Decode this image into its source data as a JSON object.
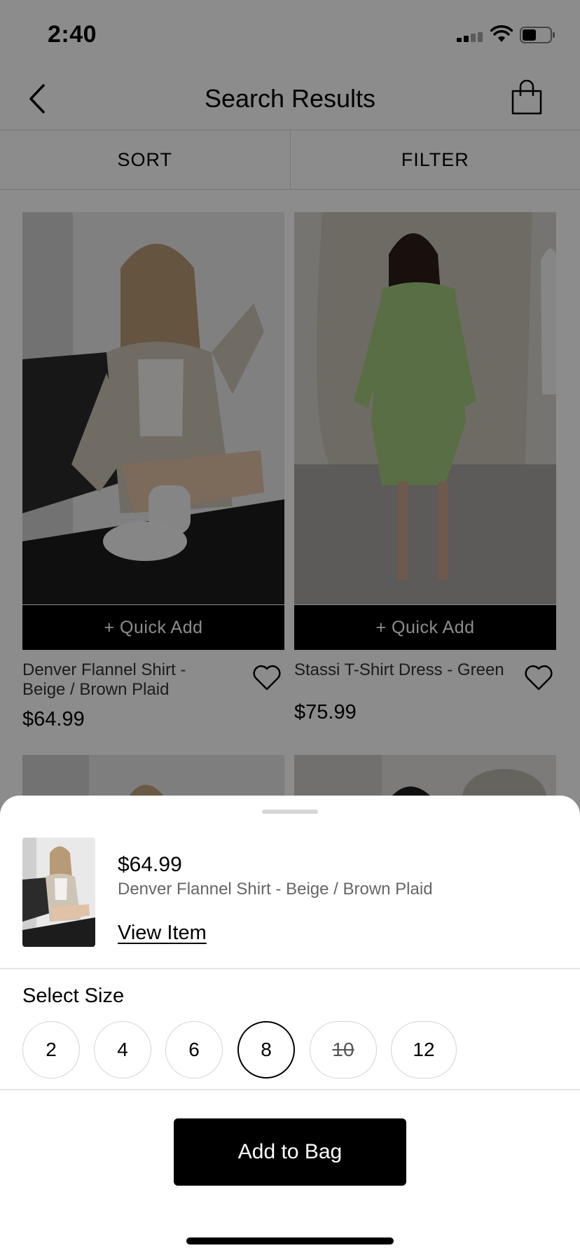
{
  "status_bar": {
    "time": "2:40"
  },
  "nav": {
    "title": "Search Results"
  },
  "toolbar": {
    "sort_label": "SORT",
    "filter_label": "FILTER"
  },
  "products": [
    {
      "name": "Denver Flannel Shirt - Beige / Brown Plaid",
      "price": "$64.99",
      "quick_add": "+ Quick Add"
    },
    {
      "name": "Stassi T-Shirt Dress - Green",
      "price": "$75.99",
      "quick_add": "+ Quick Add"
    }
  ],
  "sheet": {
    "price": "$64.99",
    "name": "Denver Flannel Shirt - Beige / Brown Plaid",
    "view_item_label": "View Item",
    "select_size_label": "Select Size",
    "sizes": [
      {
        "label": "2",
        "state": "available"
      },
      {
        "label": "4",
        "state": "available"
      },
      {
        "label": "6",
        "state": "available"
      },
      {
        "label": "8",
        "state": "selected"
      },
      {
        "label": "10",
        "state": "unavailable"
      },
      {
        "label": "12",
        "state": "available"
      }
    ],
    "add_to_bag_label": "Add to Bag"
  },
  "colors": {
    "accent": "#000000",
    "overlay": "#737373",
    "dress_green": "#a3c97e"
  }
}
